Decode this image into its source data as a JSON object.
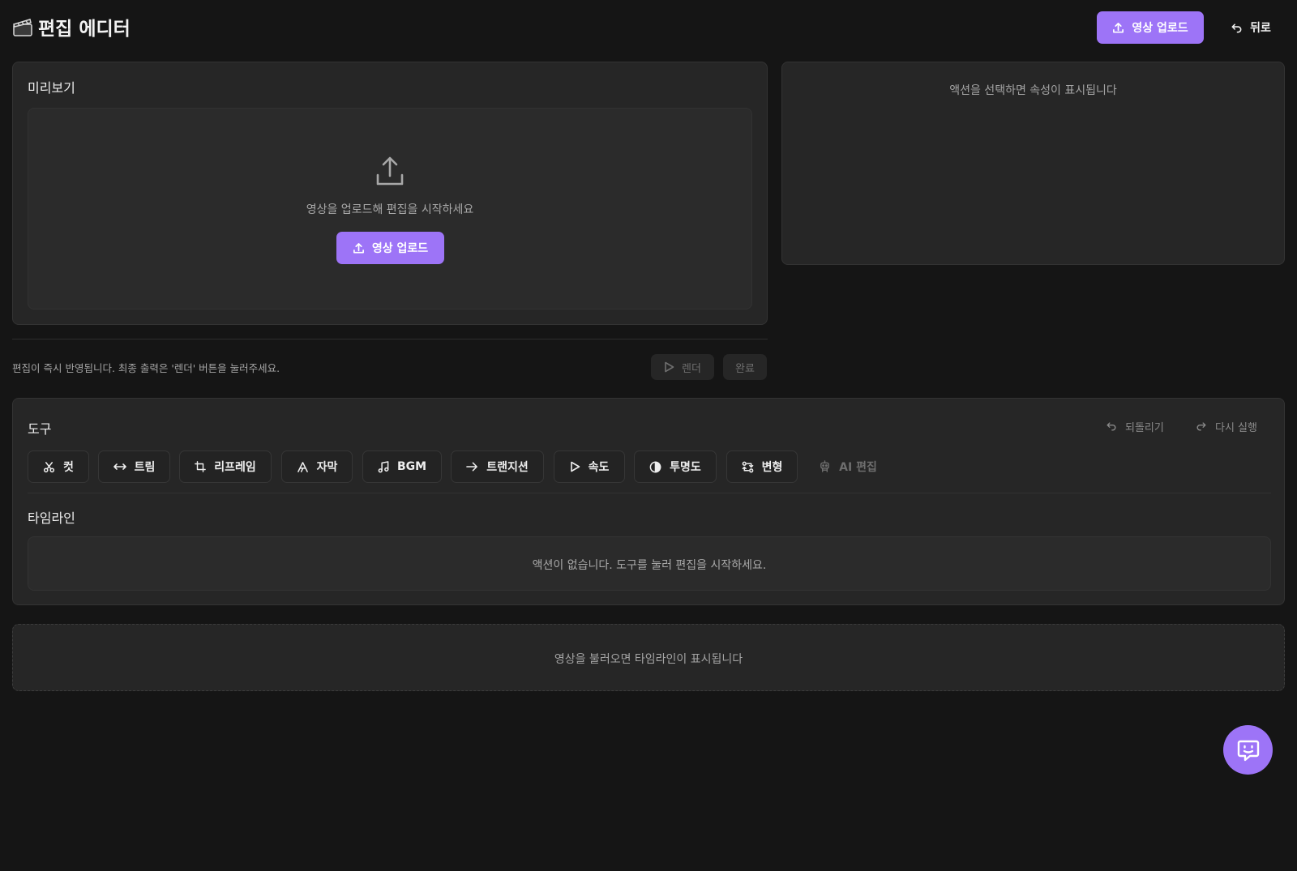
{
  "header": {
    "title": "편집 에디터",
    "upload_label": "영상 업로드",
    "back_label": "뒤로"
  },
  "preview": {
    "title": "미리보기",
    "empty_text": "영상을 업로드해 편집을 시작하세요",
    "upload_label": "영상 업로드"
  },
  "footer": {
    "hint": "편집이 즉시 반영됩니다. 최종 출력은 '렌더' 버튼을 눌러주세요.",
    "render_label": "렌더",
    "done_label": "완료"
  },
  "properties": {
    "empty_text": "액션을 선택하면 속성이 표시됩니다"
  },
  "tools": {
    "title": "도구",
    "undo_label": "되돌리기",
    "redo_label": "다시 실행",
    "items": [
      {
        "label": "컷",
        "icon": "scissors-icon"
      },
      {
        "label": "트림",
        "icon": "arrows-horizontal-icon"
      },
      {
        "label": "리프레임",
        "icon": "crop-icon"
      },
      {
        "label": "자막",
        "icon": "text-icon"
      },
      {
        "label": "BGM",
        "icon": "music-note-icon"
      },
      {
        "label": "트랜지션",
        "icon": "arrow-right-icon"
      },
      {
        "label": "속도",
        "icon": "play-icon"
      },
      {
        "label": "투명도",
        "icon": "half-circle-icon"
      },
      {
        "label": "변형",
        "icon": "transform-icon"
      },
      {
        "label": "AI 편집",
        "icon": "robot-icon",
        "disabled": true
      }
    ]
  },
  "timeline": {
    "title": "타임라인",
    "empty_text": "액션이 없습니다. 도구를 눌러 편집을 시작하세요.",
    "placeholder_text": "영상을 불러오면 타임라인이 표시됩니다"
  },
  "colors": {
    "accent": "#9d74f7",
    "background": "#151515",
    "panel": "#262626"
  }
}
